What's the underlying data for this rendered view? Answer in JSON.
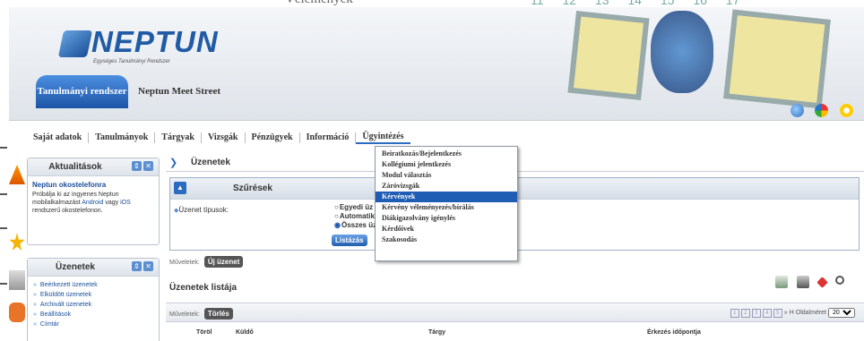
{
  "bg_window": {
    "partial_text": "Vélemények",
    "calendar_days": [
      "11",
      "12",
      "13",
      "14",
      "15",
      "16",
      "17"
    ]
  },
  "header": {
    "logo_text": "NEPTUN",
    "logo_subtitle": "Egységes Tanulmányi Rendszer",
    "system_tab": "Tanulmányi rendszer",
    "institution": "Neptun Meet Street",
    "colors": {
      "brand": "#215ba6",
      "tab": "#1d55a6"
    }
  },
  "menu": {
    "items": [
      "Saját adatok",
      "Tanulmányok",
      "Tárgyak",
      "Vizsgák",
      "Pénzügyek",
      "Információ",
      "Ügyintézés"
    ],
    "active": "Ügyintézés"
  },
  "dropdown": {
    "items": [
      "Beiratkozás/Bejelentkezés",
      "Kollégiumi jelentkezés",
      "Modul választás",
      "Záróvizsgák",
      "Kérvények",
      "Kérvény véleményezés/bírálás",
      "Diákigazolvány igénylés",
      "Kérdőívek",
      "Szakosodás"
    ],
    "highlighted": "Kérvények"
  },
  "sidebar": {
    "aktualitasok": {
      "title": "Aktualitások",
      "news_title": "Neptun okostelefonra",
      "news_body_1": "Próbálja ki az ingyenes Neptun mobilalkalmazást",
      "news_link_android": "Android",
      "news_body_2": "vagy",
      "news_link_ios": "iOS",
      "news_body_3": "rendszerű okostelefonon."
    },
    "uzenetek": {
      "title": "Üzenetek",
      "items": [
        "Beérkezett üzenetek",
        "Elküldött üzenetek",
        "Archivált üzenetek",
        "Beállítások",
        "Címtár"
      ]
    }
  },
  "main": {
    "title": "Üzenetek",
    "filter": {
      "title": "Szűrések",
      "type_label": "Üzenet típusok:",
      "radios": [
        "Egyedi üz",
        "Automatik",
        "Összes üz"
      ],
      "selected": "Összes üz",
      "button": "Listázás"
    },
    "ops_label": "Műveletek:",
    "new_message": "Új üzenet",
    "list_title": "Üzenetek listája",
    "list_ops_label": "Műveletek:",
    "delete_button": "Törlés",
    "pager": {
      "pages": [
        "1",
        "2",
        "3",
        "4",
        "5"
      ],
      "next": "»",
      "last": "H",
      "page_size_label": "Oldalméret",
      "page_size": "20"
    },
    "columns": {
      "delete": "Töröl",
      "sender": "Küldő",
      "subject": "Tárgy",
      "arrival": "Érkezés időpontja"
    }
  }
}
